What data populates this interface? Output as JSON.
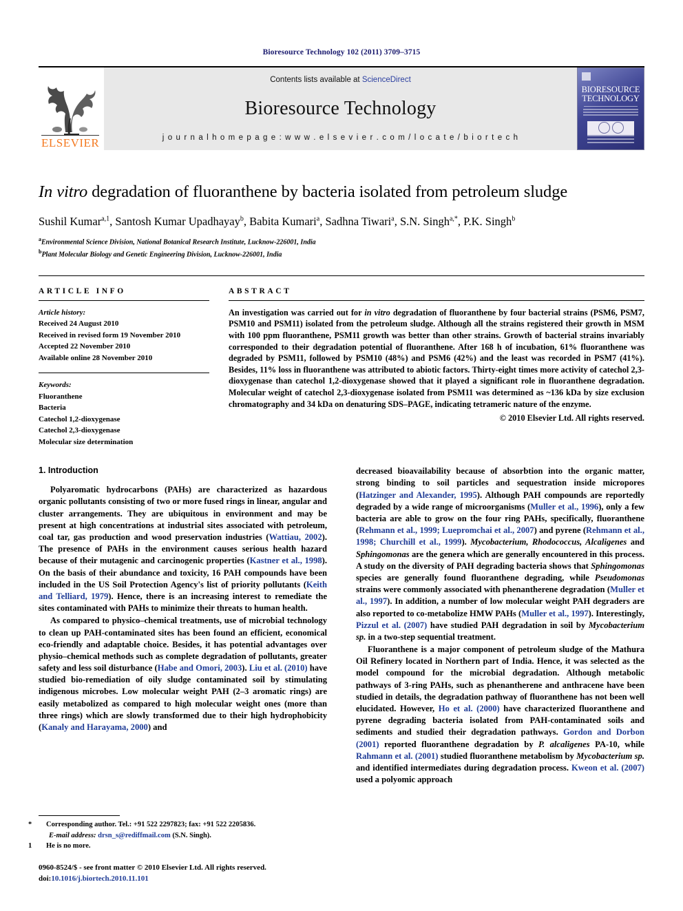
{
  "running_head": "Bioresource Technology 102 (2011) 3709–3715",
  "masthead": {
    "publisher_name": "ELSEVIER",
    "contents_prefix": "Contents lists available at ",
    "sciencedirect": "ScienceDirect",
    "journal_title": "Bioresource Technology",
    "homepage": "j o u r n a l   h o m e p a g e :   w w w . e l s e v i e r . c o m / l o c a t e / b i o r t e c h",
    "cover_title_line1": "BIORESOURCE",
    "cover_title_line2": "TECHNOLOGY"
  },
  "article": {
    "title_italic": "In vitro",
    "title_rest": " degradation of fluoranthene by bacteria isolated from petroleum sludge",
    "authors": [
      {
        "name": "Sushil Kumar",
        "sup": "a,1",
        "sep": ", "
      },
      {
        "name": "Santosh Kumar Upadhayay",
        "sup": "b",
        "sep": ", "
      },
      {
        "name": "Babita Kumari",
        "sup": "a",
        "sep": ", "
      },
      {
        "name": "Sadhna Tiwari",
        "sup": "a",
        "sep": ", "
      },
      {
        "name": "S.N. Singh",
        "sup": "a,*",
        "sep": ", "
      },
      {
        "name": "P.K. Singh",
        "sup": "b",
        "sep": ""
      }
    ],
    "affiliations": [
      {
        "mark": "a",
        "text": "Environmental Science Division, National Botanical Research Institute, Lucknow-226001, India"
      },
      {
        "mark": "b",
        "text": "Plant Molecular Biology and Genetic Engineering Division, Lucknow-226001, India"
      }
    ]
  },
  "article_info": {
    "heading": "ARTICLE INFO",
    "history_label": "Article history:",
    "history": [
      "Received 24 August 2010",
      "Received in revised form 19 November 2010",
      "Accepted 22 November 2010",
      "Available online 28 November 2010"
    ],
    "keywords_label": "Keywords:",
    "keywords": [
      "Fluoranthene",
      "Bacteria",
      "Catechol 1,2-dioxygenase",
      "Catechol 2,3-dioxygenase",
      "Molecular size determination"
    ]
  },
  "abstract": {
    "heading": "ABSTRACT",
    "part1": "An investigation was carried out for ",
    "italic1": "in vitro",
    "part2": " degradation of fluoranthene by four bacterial strains (PSM6, PSM7, PSM10 and PSM11) isolated from the petroleum sludge. Although all the strains registered their growth in MSM with 100 ppm fluoranthene, PSM11 growth was better than other strains. Growth of bacterial strains invariably corresponded to their degradation potential of fluoranthene. After 168 h of incubation, 61% fluoranthene was degraded by PSM11, followed by PSM10 (48%) and PSM6 (42%) and the least was recorded in PSM7 (41%). Besides, 11% loss in fluoranthene was attributed to abiotic factors. Thirty-eight times more activity of catechol 2,3-dioxygenase than catechol 1,2-dioxygenase showed that it played a significant role in fluoranthene degradation. Molecular weight of catechol 2,3-dioxygenase isolated from PSM11 was determined as ~136 kDa by size exclusion chromatography and 34 kDa on denaturing SDS–PAGE, indicating tetrameric nature of the enzyme.",
    "copyright": "© 2010 Elsevier Ltd. All rights reserved."
  },
  "introduction": {
    "section_title": "1. Introduction",
    "left_p1_a": "Polyaromatic hydrocarbons (PAHs) are characterized as hazardous organic pollutants consisting of two or more fused rings in linear, angular and cluster arrangements. They are ubiquitous in environment and may be present at high concentrations at industrial sites associated with petroleum, coal tar, gas production and wood preservation industries (",
    "left_p1_c1": "Wattiau, 2002",
    "left_p1_b": "). The presence of PAHs in the environment causes serious health hazard because of their mutagenic and carcinogenic properties (",
    "left_p1_c2": "Kastner et al., 1998",
    "left_p1_c": "). On the basis of their abundance and toxicity, 16 PAH compounds have been included in the US Soil Protection Agency's list of priority pollutants (",
    "left_p1_c3": "Keith and Telliard, 1979",
    "left_p1_d": "). Hence, there is an increasing interest to remediate the sites contaminated with PAHs to minimize their threats to human health.",
    "left_p2_a": "As compared to physico–chemical treatments, use of microbial technology to clean up PAH-contaminated sites has been found an efficient, economical eco-friendly and adaptable choice. Besides, it has potential advantages over physio–chemical methods such as complete degradation of pollutants, greater safety and less soil disturbance (",
    "left_p2_c1": "Habe and Omori, 2003",
    "left_p2_b": "). ",
    "left_p2_c2": "Liu et al. (2010)",
    "left_p2_c": " have studied bio-remediation of oily sludge contaminated soil by stimulating indigenous microbes. Low molecular weight PAH (2–3 aromatic rings) are easily metabolized as compared to high molecular weight ones (more than three rings) which are slowly transformed due to their high hydrophobicity (",
    "left_p2_c3": "Kanaly and Harayama, 2000",
    "left_p2_d": ") and",
    "right_p1_a": "decreased bioavailability because of absorbtion into the organic matter, strong binding to soil particles and sequestration inside micropores (",
    "right_p1_c1": "Hatzinger and Alexander, 1995",
    "right_p1_b": "). Although PAH compounds are reportedly degraded by a wide range of microorganisms (",
    "right_p1_c2": "Muller et al., 1996",
    "right_p1_c": "), only a few bacteria are able to grow on the four ring PAHs, specifically, fluoranthene (",
    "right_p1_c3": "Rehmann et al., 1999; Luepromchai et al., 2007",
    "right_p1_d": ") and pyrene (",
    "right_p1_c4": "Rehmann et al., 1998; Churchill et al., 1999",
    "right_p1_e": "). ",
    "right_p1_i1": "Mycobacterium, Rhodococcus, Alcaligenes",
    "right_p1_f": " and ",
    "right_p1_i2": "Sphingomonas",
    "right_p1_g": " are the genera which are generally encountered in this process. A study on the diversity of PAH degrading bacteria shows that ",
    "right_p1_i3": "Sphingomonas",
    "right_p1_h": " species are generally found fluoranthene degrading, while ",
    "right_p1_i4": "Pseudomonas",
    "right_p1_j": " strains were commonly associated with phenantherene degradation (",
    "right_p1_c5": "Muller et al., 1997",
    "right_p1_k": "). In addition, a number of low molecular weight PAH degraders are also reported to co-metabolize HMW PAHs (",
    "right_p1_c6": "Muller et al., 1997",
    "right_p1_l": "). Interestingly, ",
    "right_p1_c7": "Pizzul et al. (2007)",
    "right_p1_m": " have studied PAH degradation in soil by ",
    "right_p1_i5": "Mycobacterium sp.",
    "right_p1_n": " in a two-step sequential treatment.",
    "right_p2_a": "Fluoranthene is a major component of petroleum sludge of the Mathura Oil Refinery located in Northern part of India. Hence, it was selected as the model compound for the microbial degradation. Although metabolic pathways of 3-ring PAHs, such as phenantherene and anthracene have been studied in details, the degradation pathway of fluoranthene has not been well elucidated. However, ",
    "right_p2_c1": "Ho et al. (2000)",
    "right_p2_b": " have characterized fluoranthene and pyrene degrading bacteria isolated from PAH-contaminated soils and sediments and studied their degradation pathways. ",
    "right_p2_c2": "Gordon and Dorbon (2001)",
    "right_p2_c": " reported fluoranthene degradation by ",
    "right_p2_i1": "P. alcaligenes",
    "right_p2_d": " PA-10, while ",
    "right_p2_c3": "Rahmann et al. (2001)",
    "right_p2_e": " studied fluoranthene metabolism by ",
    "right_p2_i2": "Mycobacterium sp.",
    "right_p2_f": " and identified intermediates during degradation process. ",
    "right_p2_c4": "Kweon et al. (2007)",
    "right_p2_g": " used a polyomic approach"
  },
  "footnotes": {
    "corresponding": "Corresponding author. Tel.: +91 522 2297823; fax: +91 522 2205836.",
    "email_label": "E-mail address:",
    "email": "drsn_s@rediffmail.com",
    "email_suffix": " (S.N. Singh).",
    "note1_mark": "1",
    "note1": "He is no more.",
    "issn_line": "0960-8524/$ - see front matter © 2010 Elsevier Ltd. All rights reserved.",
    "doi_label": "doi:",
    "doi": "10.1016/j.biortech.2010.11.101"
  },
  "colors": {
    "citation_blue": "#1f3c96",
    "running_head_navy": "#1a1a6e",
    "elsevier_orange": "#f47920",
    "band_gray": "#e8e8e8"
  }
}
